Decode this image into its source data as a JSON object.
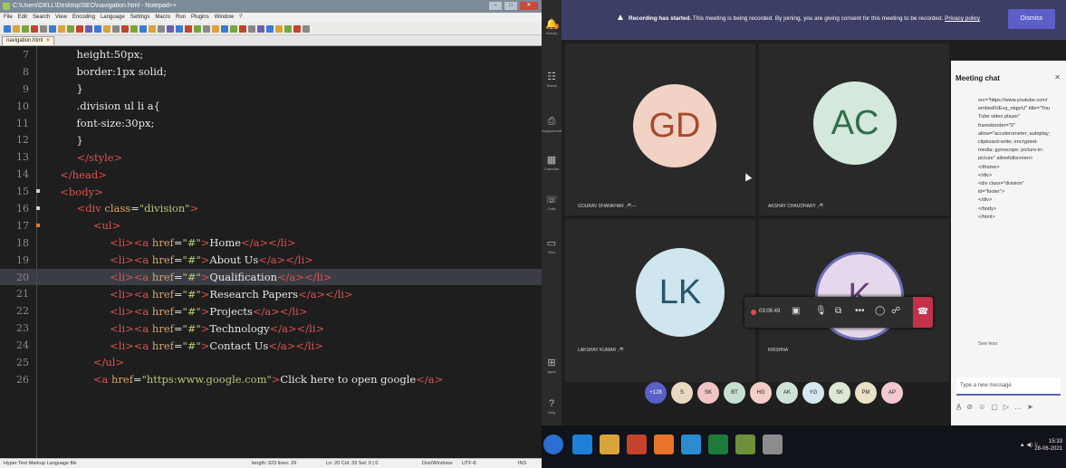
{
  "notepad": {
    "title": "C:\\Users\\DELL\\Desktop\\SEO\\navigation.html - Notepad++",
    "menu": [
      "File",
      "Edit",
      "Search",
      "View",
      "Encoding",
      "Language",
      "Settings",
      "Macro",
      "Run",
      "Plugins",
      "Window",
      "?"
    ],
    "tab_label": "navigation.html",
    "lines": [
      {
        "num": "7",
        "html": "          height:50px;"
      },
      {
        "num": "8",
        "html": "          border:1px solid;"
      },
      {
        "num": "9",
        "html": "          }"
      },
      {
        "num": "10",
        "html": "          .division ul li a{"
      },
      {
        "num": "11",
        "html": "          font-size:30px;"
      },
      {
        "num": "12",
        "html": "          }"
      },
      {
        "num": "13",
        "html": "          </style>"
      },
      {
        "num": "14",
        "html": "     </head>"
      },
      {
        "num": "15",
        "html": "     <body>"
      },
      {
        "num": "16",
        "html": "          <div class=\"division\">"
      },
      {
        "num": "17",
        "html": "               <ul>"
      },
      {
        "num": "18",
        "html": "                    <li><a href=\"#\">Home</a></li>"
      },
      {
        "num": "19",
        "html": "                    <li><a href=\"#\">About Us</a></li>"
      },
      {
        "num": "20",
        "html": "                    <li><a href=\"#\">Qualification</a></li>"
      },
      {
        "num": "21",
        "html": "                    <li><a href=\"#\">Research Papers</a></li>"
      },
      {
        "num": "22",
        "html": "                    <li><a href=\"#\">Projects</a></li>"
      },
      {
        "num": "23",
        "html": "                    <li><a href=\"#\">Technology</a></li>"
      },
      {
        "num": "24",
        "html": "                    <li><a href=\"#\">Contact Us</a></li>"
      },
      {
        "num": "25",
        "html": "               </ul>"
      },
      {
        "num": "26",
        "html": "               <a href=\"https:www.google.com\">Click here to open google</a>"
      }
    ],
    "status": {
      "language": "Hyper Text Markup Language file",
      "length": "length: 923   lines: 29",
      "position": "Ln: 20   Col: 33   Sel: 0 | 0",
      "eol": "Dos\\Windows",
      "encoding": "UTF-8",
      "mode": "INS"
    }
  },
  "teams": {
    "rail": [
      "Activity",
      "Teams",
      "Assignments",
      "Calendar",
      "Calls",
      "Files",
      "Apps",
      "Help"
    ],
    "banner": {
      "bold": "Recording has started.",
      "text": " This meeting is being recorded. By joining, you are giving consent for this meeting to be recorded.",
      "link": "Privacy policy",
      "dismiss": "Dismiss"
    },
    "participants": [
      {
        "initials": "GD",
        "name": "GOURAV DHANKHAR",
        "bg": "#f3d2c6",
        "fg": "#a9492e"
      },
      {
        "initials": "AC",
        "name": "AKSHAY CHAUDHARY",
        "bg": "#d5e8dc",
        "fg": "#2f6f4a"
      },
      {
        "initials": "LK",
        "name": "LAKSHAY KUMAR",
        "bg": "#cfe6ee",
        "fg": "#26566b"
      },
      {
        "initials": "K",
        "name": "KRISHNA",
        "bg": "#e6d8ec",
        "fg": "#6a3f7e"
      }
    ],
    "call_timer": "03:06:49",
    "chips": [
      "+128",
      "S",
      "SK",
      "BT",
      "HG",
      "AK",
      "YG",
      "SK",
      "PM",
      "AP"
    ],
    "chat": {
      "header": "Meeting chat",
      "lines": [
        "src=\"https://www.youtube.com/",
        "embed/UEvq_ntqprU\" title=\"You",
        "Tube video player\"",
        "frameborder=\"0\"",
        "allow=\"accelerometer; autoplay;",
        "clipboard-write; encrypted-",
        "media; gyroscope; picture-in-",
        "picture\" allowfullscreen>",
        "</iframe>",
        "     </div>",
        "     <div class=\"division\"",
        "id=\"footer\">",
        "     </div>",
        "     </body>",
        "</html>"
      ],
      "seen": "See less",
      "input_placeholder": "Type a new message"
    },
    "clock": {
      "time": "15:33",
      "date": "28-06-2021"
    }
  }
}
